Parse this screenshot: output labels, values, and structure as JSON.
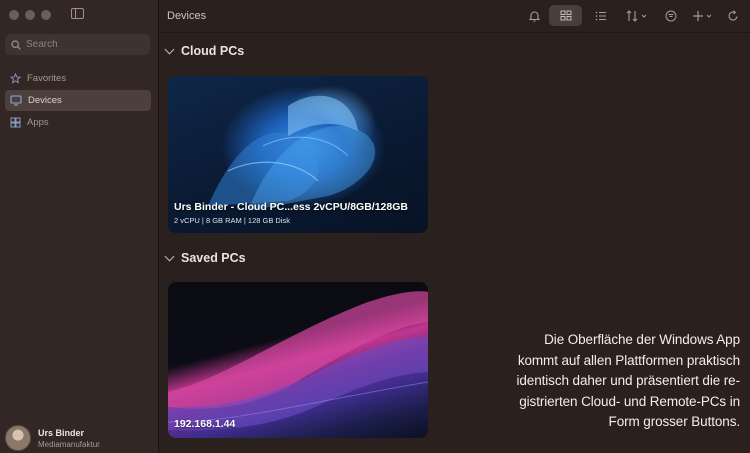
{
  "window": {
    "traffic_lights": [
      "close",
      "minimize",
      "zoom"
    ]
  },
  "sidebar": {
    "search": {
      "placeholder": "Search",
      "value": ""
    },
    "items": [
      {
        "label": "Favorites",
        "icon": "star-icon",
        "active": false
      },
      {
        "label": "Devices",
        "icon": "monitor-icon",
        "active": true
      },
      {
        "label": "Apps",
        "icon": "apps-grid-icon",
        "active": false
      }
    ],
    "user": {
      "name": "Urs Binder",
      "org": "Mediamanufaktur"
    }
  },
  "toolbar": {
    "title": "Devices",
    "icons": [
      "bell-icon",
      "grid-view-icon",
      "list-view-icon",
      "sort-icon",
      "filter-icon",
      "add-icon",
      "refresh-icon"
    ]
  },
  "sections": {
    "cloud": {
      "heading": "Cloud PCs",
      "card": {
        "title": "Urs Binder - Cloud PC...ess 2vCPU/8GB/128GB",
        "specs": "2 vCPU | 8 GB RAM | 128 GB Disk"
      }
    },
    "saved": {
      "heading": "Saved PCs",
      "card": {
        "title": "192.168.1.44"
      }
    }
  },
  "caption": {
    "line1": "Die Oberfläche der Windows App",
    "line2": "kommt auf allen Plattformen praktisch",
    "line3": "identisch daher und präsentiert die re-",
    "line4": "gistrierten Cloud- und Remote-PCs in",
    "line5": "Form grosser Buttons."
  },
  "colors": {
    "sidebar_bg": "#322724",
    "main_bg": "#2a201d",
    "active_item": "#4d403c"
  }
}
